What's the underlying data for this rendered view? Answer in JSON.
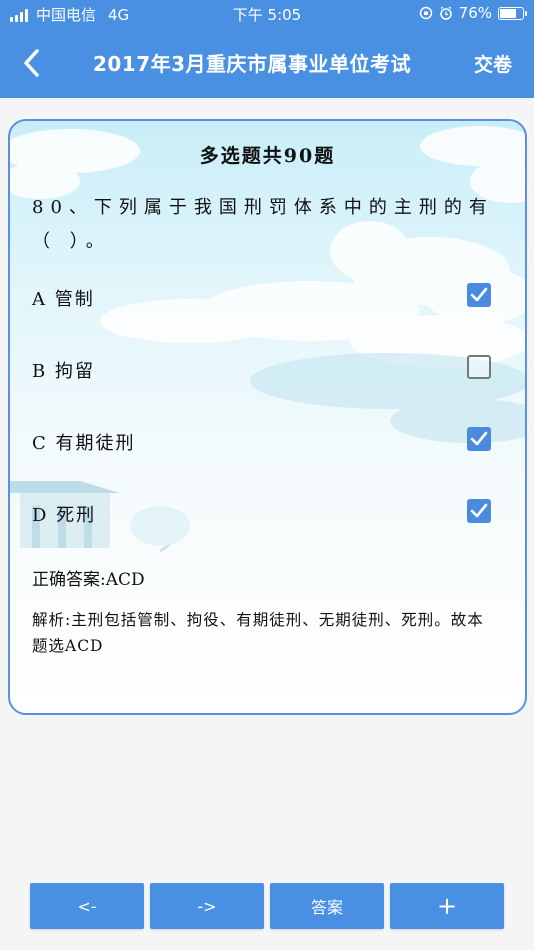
{
  "status_bar": {
    "carrier": "中国电信",
    "network": "4G",
    "time": "下午 5:05",
    "battery_text": "76%",
    "battery_level": 0.76
  },
  "nav": {
    "back_icon": "chevron-left-icon",
    "title": "2017年3月重庆市属事业单位考试",
    "submit_label": "交卷"
  },
  "question": {
    "heading": "多选题共90题",
    "text": "80、下列属于我国刑罚体系中的主刑的有（ ）。",
    "options": [
      {
        "label": "A 管制",
        "checked": true
      },
      {
        "label": "B 拘留",
        "checked": false
      },
      {
        "label": "C 有期徒刑",
        "checked": true
      },
      {
        "label": "D 死刑",
        "checked": true
      }
    ],
    "answer": "正确答案:ACD",
    "analysis": "解析:主刑包括管制、拘役、有期徒刑、无期徒刑、死刑。故本题选ACD"
  },
  "bottom_bar": {
    "prev_label": "<-",
    "next_label": "->",
    "answer_label": "答案",
    "add_label": "+"
  },
  "colors": {
    "primary": "#4a90e2",
    "card_border": "#5b8fe6",
    "checkbox_checked": "#4a8be0"
  }
}
